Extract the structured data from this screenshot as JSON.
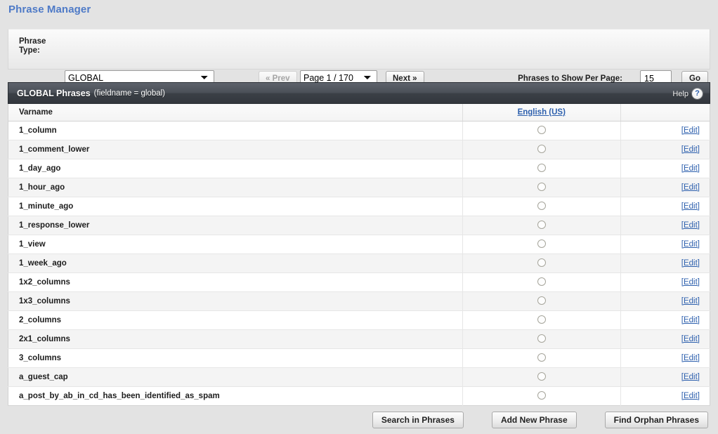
{
  "page_title": "Phrase Manager",
  "toolbar": {
    "phrase_type_label": "Phrase Type:",
    "phrase_type_value": "GLOBAL",
    "phrase_type_options": [
      "GLOBAL"
    ],
    "prev_label": "« Prev",
    "next_label": "Next »",
    "page_value": "Page 1 / 170",
    "page_options": [
      "Page 1 / 170"
    ],
    "per_page_label": "Phrases to Show Per Page:",
    "per_page_value": "15",
    "go_label": "Go"
  },
  "block": {
    "title": "GLOBAL Phrases",
    "subtitle": "(fieldname = global)",
    "help_label": "Help",
    "help_icon": "question-mark-icon"
  },
  "table": {
    "columns": {
      "varname": "Varname",
      "language": "English (US)",
      "action": ""
    },
    "edit_label": "[Edit]",
    "rows": [
      {
        "varname": "1_column"
      },
      {
        "varname": "1_comment_lower"
      },
      {
        "varname": "1_day_ago"
      },
      {
        "varname": "1_hour_ago"
      },
      {
        "varname": "1_minute_ago"
      },
      {
        "varname": "1_response_lower"
      },
      {
        "varname": "1_view"
      },
      {
        "varname": "1_week_ago"
      },
      {
        "varname": "1x2_columns"
      },
      {
        "varname": "1x3_columns"
      },
      {
        "varname": "2_columns"
      },
      {
        "varname": "2x1_columns"
      },
      {
        "varname": "3_columns"
      },
      {
        "varname": "a_guest_cap"
      },
      {
        "varname": "a_post_by_ab_in_cd_has_been_identified_as_spam"
      }
    ]
  },
  "footer": {
    "search_label": "Search in Phrases",
    "add_label": "Add New Phrase",
    "orphan_label": "Find Orphan Phrases"
  },
  "colors": {
    "title_blue": "#4e7ac7",
    "link_blue": "#2c5fad",
    "header_dark": "#3b4047",
    "page_bg": "#e3e3e3"
  }
}
